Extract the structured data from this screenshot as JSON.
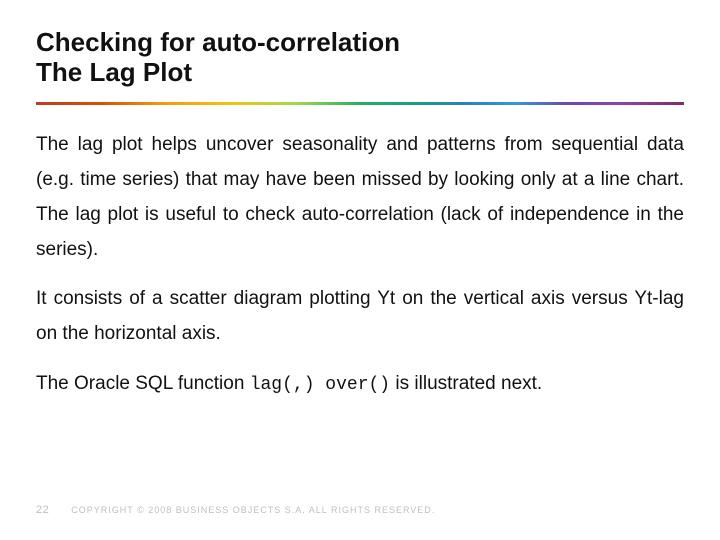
{
  "title": {
    "line1": "Checking for auto-correlation",
    "line2": "The Lag Plot"
  },
  "body": {
    "p1": "The lag plot helps uncover seasonality and patterns from sequential data (e.g. time series) that may have been missed by looking only at a line chart. The lag plot is useful to check auto-correlation (lack of independence in the series).",
    "p2": "It consists of a scatter diagram plotting Yt on the vertical axis versus Yt-lag on the horizontal axis.",
    "p3_pre": "The Oracle SQL function ",
    "p3_code": "lag(,) over()",
    "p3_post": " is illustrated next."
  },
  "footer": {
    "page": "22",
    "copyright": "COPYRIGHT © 2008 BUSINESS OBJECTS S.A.  ALL RIGHTS RESERVED."
  }
}
